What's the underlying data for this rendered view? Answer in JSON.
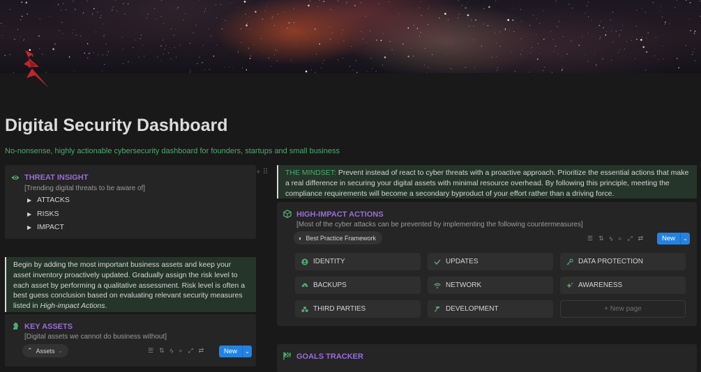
{
  "page": {
    "title": "Digital Security Dashboard",
    "subtitle": "No-nonsense, highly actionable cybersecurity dashboard for founders, startups and small business"
  },
  "colors": {
    "accent_green": "#4dab6f",
    "heading_purple": "#9a6dd7",
    "button_blue": "#2383e2",
    "logo_red": "#c0262a"
  },
  "threat_insight": {
    "title": "THREAT INSIGHT",
    "icon": "eye-icon",
    "description": "[Trending digital threats to be aware of]",
    "toggles": [
      "ATTACKS",
      "RISKS",
      "IMPACT"
    ]
  },
  "assets_callout": {
    "text": "Begin by adding the most important business assets and keep your asset inventory proactively updated. Gradually assign the risk level to each asset by performing a qualitative assessment. Risk level is often a best guess conclusion based on evaluating relevant security measures listed in ",
    "emphasis": "High-impact Actions",
    "suffix": "."
  },
  "key_assets": {
    "title": "KEY ASSETS",
    "icon": "chess-knight-icon",
    "description": "[Digital assets we cannot do business without]",
    "view_chip": "Assets",
    "new_label": "New"
  },
  "mindset": {
    "label": "THE MINDSET:",
    "text": " Prevent instead of react to cyber threats with a proactive approach. Prioritize the essential actions that make a real difference in securing your digital assets with minimal resource overhead. By following this principle, meeting the compliance requirements will become a secondary byproduct of your effort rather than a driving force."
  },
  "high_impact": {
    "title": "HIGH-IMPACT ACTIONS",
    "icon": "cube-icon",
    "description": "[Most of the cyber attacks can be prevented by implementing the following countermeasures]",
    "view_chip": "Best Practice Framework",
    "new_label": "New",
    "cards": [
      {
        "label": "IDENTITY",
        "icon": "user-circle-icon"
      },
      {
        "label": "UPDATES",
        "icon": "check-icon"
      },
      {
        "label": "DATA PROTECTION",
        "icon": "key-icon"
      },
      {
        "label": "BACKUPS",
        "icon": "cloud-upload-icon"
      },
      {
        "label": "NETWORK",
        "icon": "wifi-icon"
      },
      {
        "label": "AWARENESS",
        "icon": "sparkle-icon"
      },
      {
        "label": "THIRD PARTIES",
        "icon": "group-icon"
      },
      {
        "label": "DEVELOPMENT",
        "icon": "hammer-icon"
      }
    ],
    "new_page_label": "+ New page"
  },
  "goals_tracker": {
    "title": "GOALS TRACKER",
    "icon": "flag-icon"
  }
}
